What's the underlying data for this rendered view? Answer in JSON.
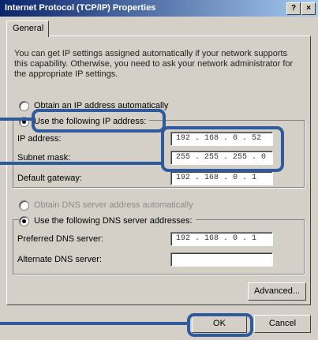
{
  "window": {
    "title": "Internet Protocol (TCP/IP) Properties",
    "help_button": "?",
    "close_button": "×"
  },
  "tabs": [
    {
      "label": "General"
    }
  ],
  "description": "You can get IP settings assigned automatically if your network supports this capability. Otherwise, you need to ask your network administrator for the appropriate IP settings.",
  "ip_section": {
    "auto_option": "Obtain an IP address automatically",
    "manual_option": "Use the following IP address:",
    "selected": "manual",
    "fields": [
      {
        "label": "IP address:",
        "value": "192 . 168 .  0  .  52"
      },
      {
        "label": "Subnet mask:",
        "value": "255 . 255 . 255 .  0"
      },
      {
        "label": "Default gateway:",
        "value": "192 . 168 .  0  .  1"
      }
    ]
  },
  "dns_section": {
    "auto_option": "Obtain DNS server address automatically",
    "manual_option": "Use the following DNS server addresses:",
    "selected": "manual",
    "fields": [
      {
        "label": "Preferred DNS server:",
        "value": "192 . 168 .  0  .  1"
      },
      {
        "label": "Alternate DNS server:",
        "value": ""
      }
    ]
  },
  "buttons": {
    "advanced": "Advanced...",
    "ok": "OK",
    "cancel": "Cancel"
  },
  "colors": {
    "title_bar_start": "#0a246a",
    "title_bar_end": "#a6caf0",
    "dialog_bg": "#d4d0c8",
    "callout": "#2f5b9e"
  }
}
